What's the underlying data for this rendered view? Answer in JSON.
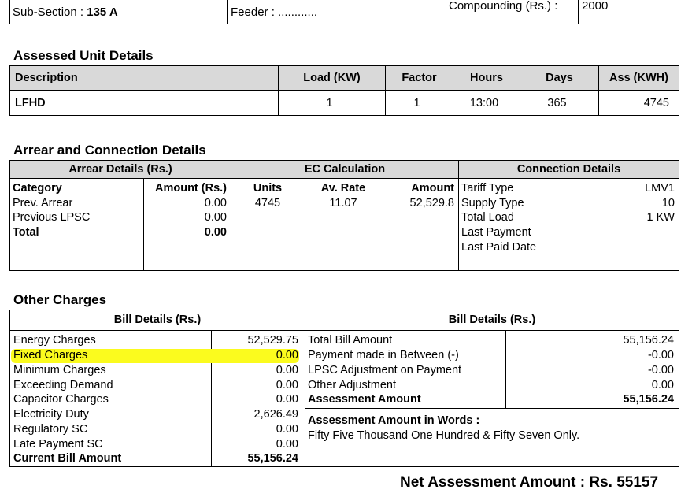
{
  "header": {
    "sub_section_label": "Sub-Section :",
    "sub_section_value": "135 A",
    "feeder_label": "Feeder :",
    "feeder_value": "............",
    "compounding_label": "Compounding (Rs.) :",
    "compounding_value": "2000"
  },
  "assessed": {
    "title": "Assessed Unit Details",
    "columns": [
      "Description",
      "Load (KW)",
      "Factor",
      "Hours",
      "Days",
      "Ass (KWH)"
    ],
    "row": [
      "LFHD",
      "1",
      "1",
      "13:00",
      "365",
      "4745"
    ]
  },
  "arrear": {
    "title": "Arrear and Connection Details",
    "group_arrear": "Arrear Details (Rs.)",
    "group_ec": "EC Calculation",
    "group_conn": "Connection Details",
    "category_label": "Category",
    "amount_label": "Amount (Rs.)",
    "rows": [
      {
        "label": "Prev. Arrear",
        "value": "0.00"
      },
      {
        "label": "Previous LPSC",
        "value": "0.00"
      },
      {
        "label": "Total",
        "value": "0.00"
      }
    ],
    "ec_units_label": "Units",
    "ec_rate_label": "Av. Rate",
    "ec_amount_label": "Amount",
    "ec_units": "4745",
    "ec_rate": "11.07",
    "ec_amount": "52,529.8",
    "conn": [
      {
        "label": "Tariff Type",
        "value": "LMV1"
      },
      {
        "label": "Supply Type",
        "value": "10"
      },
      {
        "label": "Total Load",
        "value": "1 KW"
      },
      {
        "label": "Last Payment",
        "value": ""
      },
      {
        "label": "Last Paid Date",
        "value": ""
      }
    ]
  },
  "other": {
    "title": "Other Charges",
    "left_header": "Bill Details (Rs.)",
    "right_header": "Bill Details (Rs.)",
    "left_rows": [
      {
        "label": "Energy Charges",
        "value": "52,529.75"
      },
      {
        "label": "Fixed Charges",
        "value": "0.00"
      },
      {
        "label": "Minimum Charges",
        "value": "0.00"
      },
      {
        "label": "Exceeding Demand",
        "value": "0.00"
      },
      {
        "label": "Capacitor Charges",
        "value": "0.00"
      },
      {
        "label": "Electricity Duty",
        "value": "2,626.49"
      },
      {
        "label": "Regulatory SC",
        "value": "0.00"
      },
      {
        "label": "Late Payment SC",
        "value": "0.00"
      },
      {
        "label": "Current Bill Amount",
        "value": "55,156.24"
      }
    ],
    "right_rows": [
      {
        "label": "Total Bill Amount",
        "value": "55,156.24"
      },
      {
        "label": "Payment made in Between (-)",
        "value": "-0.00"
      },
      {
        "label": "LPSC Adjustment on Payment",
        "value": "-0.00"
      },
      {
        "label": "Other Adjustment",
        "value": "0.00"
      },
      {
        "label": "Assessment Amount",
        "value": "55,156.24"
      }
    ],
    "words_label": "Assessment Amount in Words :",
    "words_value": "Fifty Five Thousand One Hundred & Fifty Seven Only."
  },
  "net": {
    "text": "Net Assessment Amount : Rs. 55157"
  },
  "colors": {
    "header_bg": "#d9d9d9",
    "highlight": "#fbfb1e"
  }
}
